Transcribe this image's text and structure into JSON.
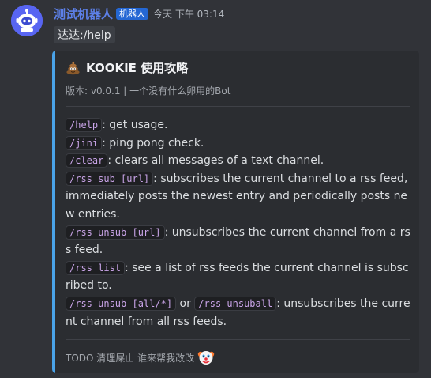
{
  "message": {
    "avatar_icon": "robot-icon",
    "username": "测试机器人",
    "bot_tag": "机器人",
    "timestamp": "今天 下午 03:14",
    "content": "达达:/help"
  },
  "embed": {
    "accent_color": "#4aa3e8",
    "title_icon": "poop-emoji-icon",
    "title": "KOOKIE 使用攻略",
    "subtitle": "版本: v0.0.1 | 一个没有什么卵用的Bot",
    "commands": [
      {
        "code": "/help",
        "text": ": get usage."
      },
      {
        "code": "/jini",
        "text": ": ping pong check."
      },
      {
        "code": "/clear",
        "text": ": clears all messages of a text channel."
      },
      {
        "code": "/rss sub [url]",
        "text": ": subscribes the current channel to a rss feed, immediately posts the newest entry and periodically posts new entries."
      },
      {
        "code": "/rss unsub [url]",
        "text": ": unsubscribes the current channel from a rss feed."
      },
      {
        "code": "/rss list",
        "text": ": see a list of rss feeds the current channel is subscribed to."
      },
      {
        "code": "/rss unsub [all/*]",
        "connector": " or ",
        "code2": "/rss unsuball",
        "text": ": unsubscribes the current channel from all rss feeds."
      }
    ],
    "footer": "TODO 清理屎山 谁来帮我改改",
    "footer_icon": "clown-face-icon"
  }
}
